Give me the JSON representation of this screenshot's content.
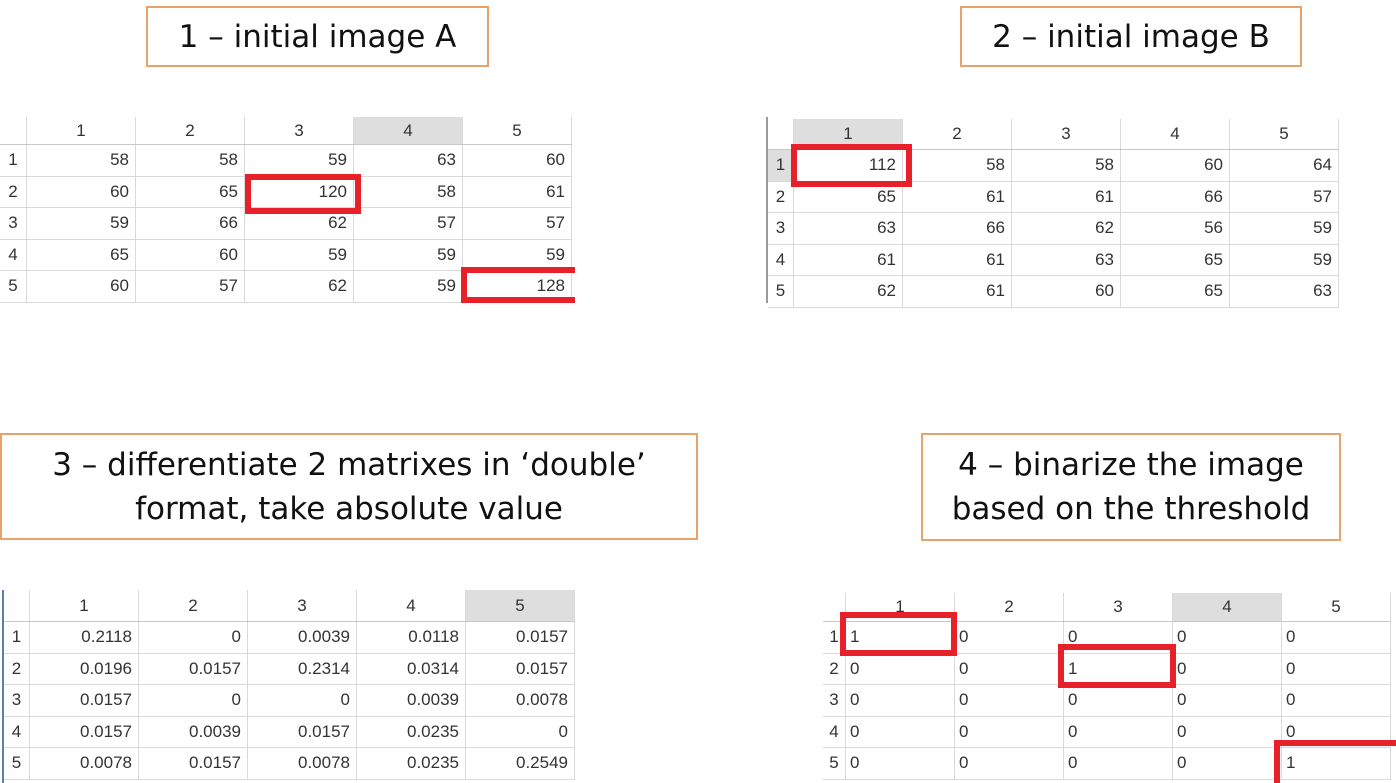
{
  "captions": {
    "c1": "1 – initial image A",
    "c2": "2 – initial image B",
    "c3_l1": "3 – differentiate 2 matrixes in ‘double’",
    "c3_l2": "format, take absolute value",
    "c4_l1": "4 – binarize the image",
    "c4_l2": "based on the threshold"
  },
  "tables": {
    "a": {
      "cols": [
        "1",
        "2",
        "3",
        "4",
        "5"
      ],
      "rows": [
        [
          "1",
          "58",
          "58",
          "59",
          "63",
          "60"
        ],
        [
          "2",
          "60",
          "65",
          "120",
          "58",
          "61"
        ],
        [
          "3",
          "59",
          "66",
          "62",
          "57",
          "57"
        ],
        [
          "4",
          "65",
          "60",
          "59",
          "59",
          "59"
        ],
        [
          "5",
          "60",
          "57",
          "62",
          "59",
          "128"
        ]
      ]
    },
    "b": {
      "cols": [
        "1",
        "2",
        "3",
        "4",
        "5"
      ],
      "rows": [
        [
          "1",
          "112",
          "58",
          "58",
          "60",
          "64"
        ],
        [
          "2",
          "65",
          "61",
          "61",
          "66",
          "57"
        ],
        [
          "3",
          "63",
          "66",
          "62",
          "56",
          "59"
        ],
        [
          "4",
          "61",
          "61",
          "63",
          "65",
          "59"
        ],
        [
          "5",
          "62",
          "61",
          "60",
          "65",
          "63"
        ]
      ]
    },
    "c": {
      "cols": [
        "1",
        "2",
        "3",
        "4",
        "5"
      ],
      "rows": [
        [
          "1",
          "0.2118",
          "0",
          "0.0039",
          "0.0118",
          "0.0157"
        ],
        [
          "2",
          "0.0196",
          "0.0157",
          "0.2314",
          "0.0314",
          "0.0157"
        ],
        [
          "3",
          "0.0157",
          "0",
          "0",
          "0.0039",
          "0.0078"
        ],
        [
          "4",
          "0.0157",
          "0.0039",
          "0.0157",
          "0.0235",
          "0"
        ],
        [
          "5",
          "0.0078",
          "0.0157",
          "0.0078",
          "0.0235",
          "0.2549"
        ]
      ]
    },
    "d": {
      "cols": [
        "1",
        "2",
        "3",
        "4",
        "5"
      ],
      "rows": [
        [
          "1",
          "1",
          "0",
          "0",
          "0",
          "0"
        ],
        [
          "2",
          "0",
          "0",
          "1",
          "0",
          "0"
        ],
        [
          "3",
          "0",
          "0",
          "0",
          "0",
          "0"
        ],
        [
          "4",
          "0",
          "0",
          "0",
          "0",
          "0"
        ],
        [
          "5",
          "0",
          "0",
          "0",
          "0",
          "1"
        ]
      ]
    }
  },
  "colors": {
    "caption_border": "#e8a26a",
    "highlight": "#e8202a",
    "selected_header": "#dedede"
  }
}
